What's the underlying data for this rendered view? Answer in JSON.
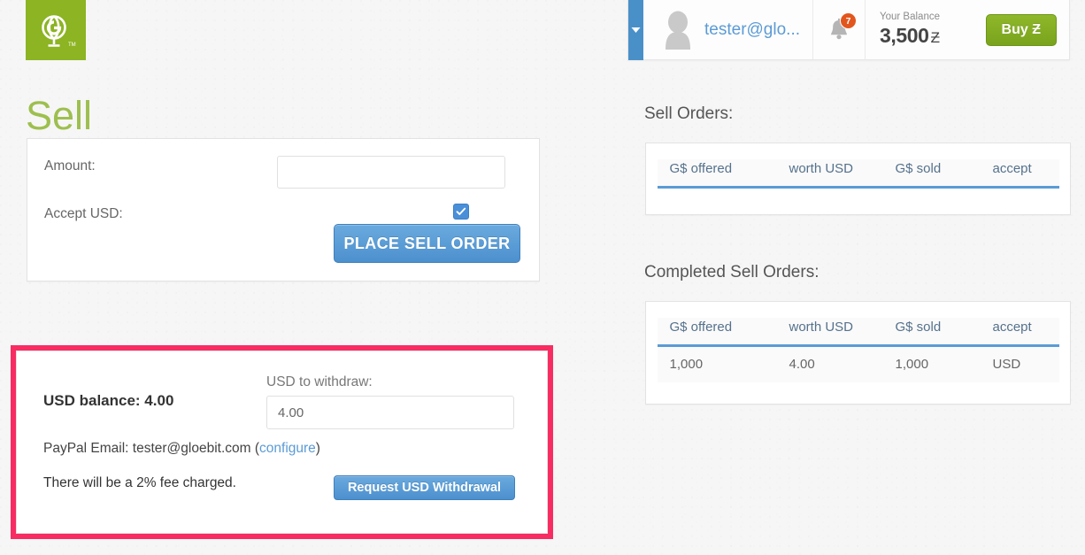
{
  "brand": {
    "logo_icon": "gloebit-g-globe-logo",
    "logo_color": "#8cb423",
    "trademark": "TM"
  },
  "page": {
    "title": "Sell",
    "title_color": "#9dbf4f"
  },
  "sell_form": {
    "amount_label": "Amount:",
    "amount_value": "",
    "amount_placeholder": "",
    "accept_usd_label": "Accept USD:",
    "accept_usd_checked": true,
    "accept_usd_checkbox_color": "#4a90d9",
    "submit_label": "PLACE SELL ORDER",
    "submit_color": "#4c90ce"
  },
  "withdraw": {
    "highlight_color": "#f82c62",
    "balance_label": "USD balance: 4.00",
    "withdraw_field_label": "USD to withdraw:",
    "withdraw_field_value": "4.00",
    "paypal_prefix": "PayPal Email: tester@gloebit.com (",
    "paypal_configure_link": "configure",
    "paypal_suffix": ")",
    "fee_notice": "There will be a 2% fee charged.",
    "request_button_label": "Request USD Withdrawal",
    "link_color": "#5b9bd5"
  },
  "topbar": {
    "toggle_icon": "chevron-down-icon",
    "toggle_color": "#4a90c8",
    "avatar_icon": "user-avatar-icon",
    "user_email": "tester@glo...",
    "bell_icon": "bell-icon",
    "notification_count": "7",
    "notification_badge_color": "#e2561e",
    "balance_caption": "Your Balance",
    "balance_amount": "3,500",
    "balance_currency": "Ƶ",
    "buy_label": "Buy Ƶ",
    "buy_color": "#8fb82b"
  },
  "sell_orders": {
    "heading": "Sell Orders:",
    "columns": [
      "G$ offered",
      "worth USD",
      "G$ sold",
      "accept"
    ],
    "rows": []
  },
  "completed_sell_orders": {
    "heading": "Completed Sell Orders:",
    "columns": [
      "G$ offered",
      "worth USD",
      "G$ sold",
      "accept"
    ],
    "rows": [
      [
        "1,000",
        "4.00",
        "1,000",
        "USD"
      ]
    ]
  }
}
